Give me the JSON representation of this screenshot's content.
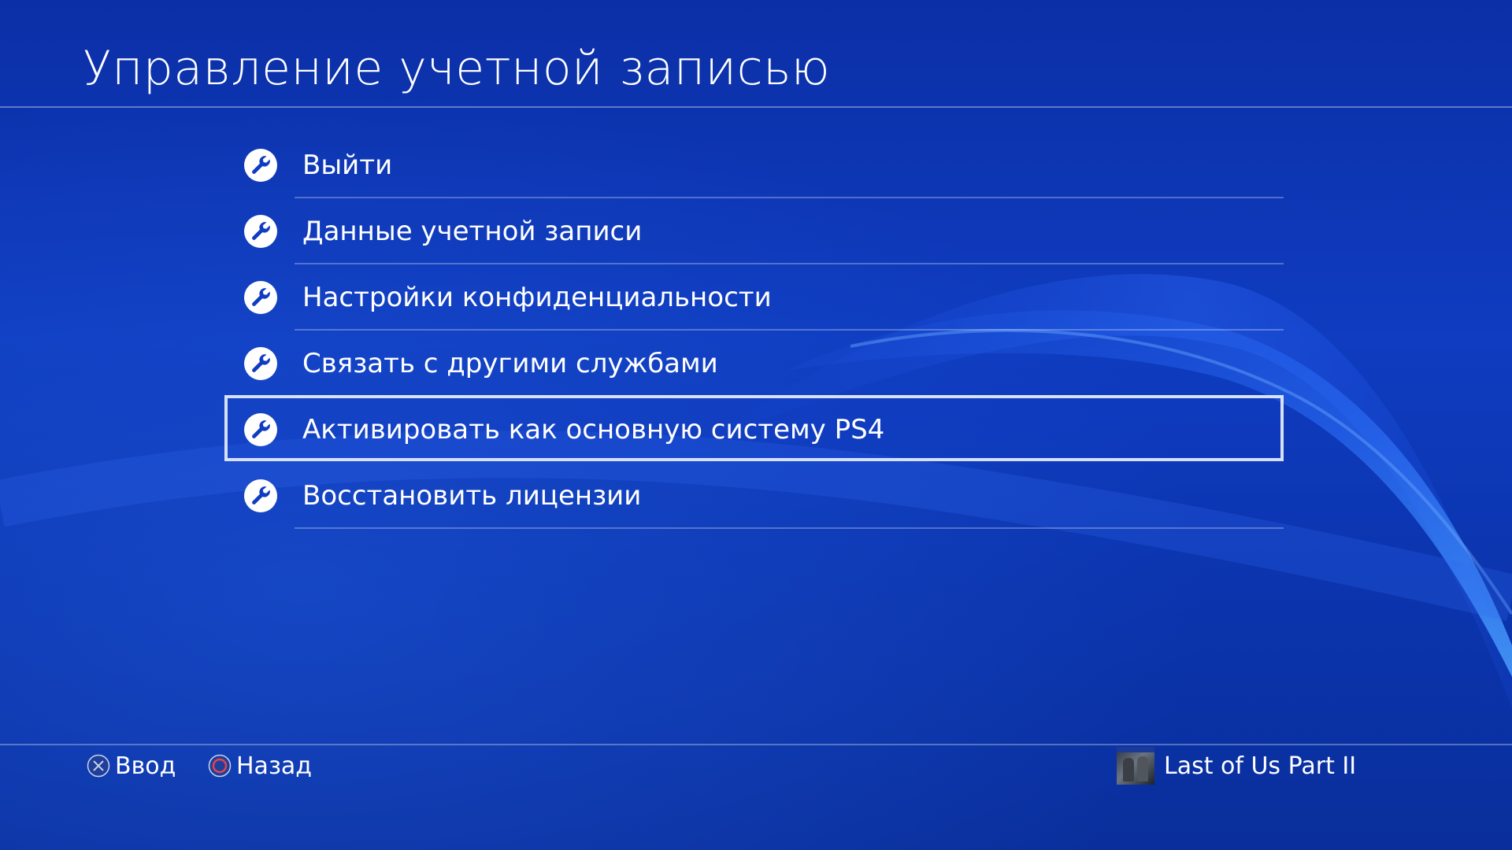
{
  "header": {
    "title": "Управление учетной записью"
  },
  "menu": {
    "items": [
      {
        "label": "Выйти",
        "icon": "wrench-icon"
      },
      {
        "label": "Данные учетной записи",
        "icon": "wrench-icon"
      },
      {
        "label": "Настройки конфиденциальности",
        "icon": "wrench-icon"
      },
      {
        "label": "Связать с другими службами",
        "icon": "wrench-icon"
      },
      {
        "label": "Активировать как основную систему PS4",
        "icon": "wrench-icon",
        "selected": true
      },
      {
        "label": "Восстановить лицензии",
        "icon": "wrench-icon"
      }
    ]
  },
  "footer": {
    "enter_label": "Ввод",
    "enter_icon": "cross-button-icon",
    "back_label": "Назад",
    "back_icon": "circle-button-icon",
    "game_title": "Last of Us Part II"
  },
  "colors": {
    "background": "#0f3cc0",
    "text": "#ffffff",
    "focus_frame": "#e6eeff",
    "circle_button": "#e8434c"
  }
}
